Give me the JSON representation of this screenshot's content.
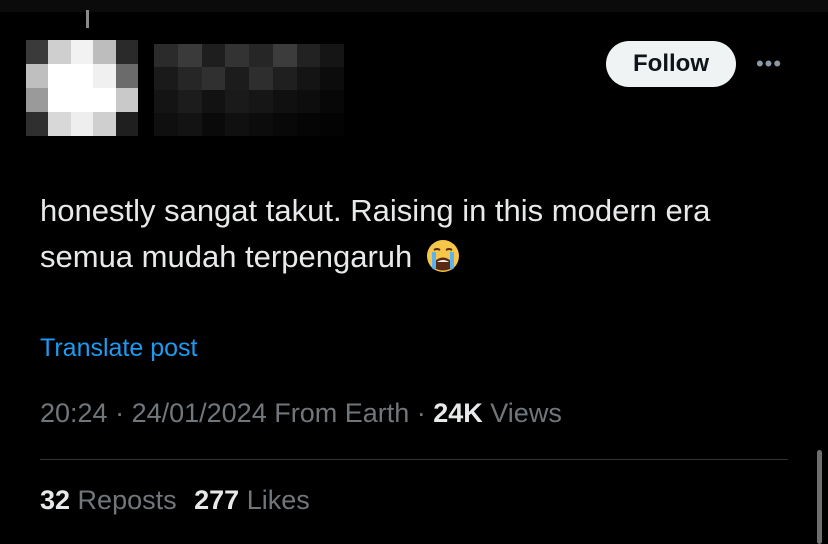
{
  "header": {
    "follow_label": "Follow",
    "more_glyph": "•••"
  },
  "post": {
    "text": "honestly sangat takut. Raising in this modern era semua mudah terpengaruh",
    "emoji": "loudly-crying-face",
    "translate_label": "Translate post"
  },
  "meta": {
    "time": "20:24",
    "sep1": " · ",
    "date": "24/01/2024",
    "source": " From Earth",
    "sep2": " · ",
    "views_count": "24K",
    "views_label": " Views"
  },
  "stats": {
    "reposts_count": "32",
    "reposts_label": " Reposts",
    "likes_count": "277",
    "likes_label": " Likes"
  },
  "colors": {
    "background": "#000000",
    "text_primary": "#e7e9ea",
    "text_secondary": "#71767b",
    "link": "#1d9bf0",
    "follow_bg": "#eff3f4"
  },
  "icons": {
    "more": "more-horizontal-icon",
    "emoji": "loudly-crying-face-icon"
  }
}
